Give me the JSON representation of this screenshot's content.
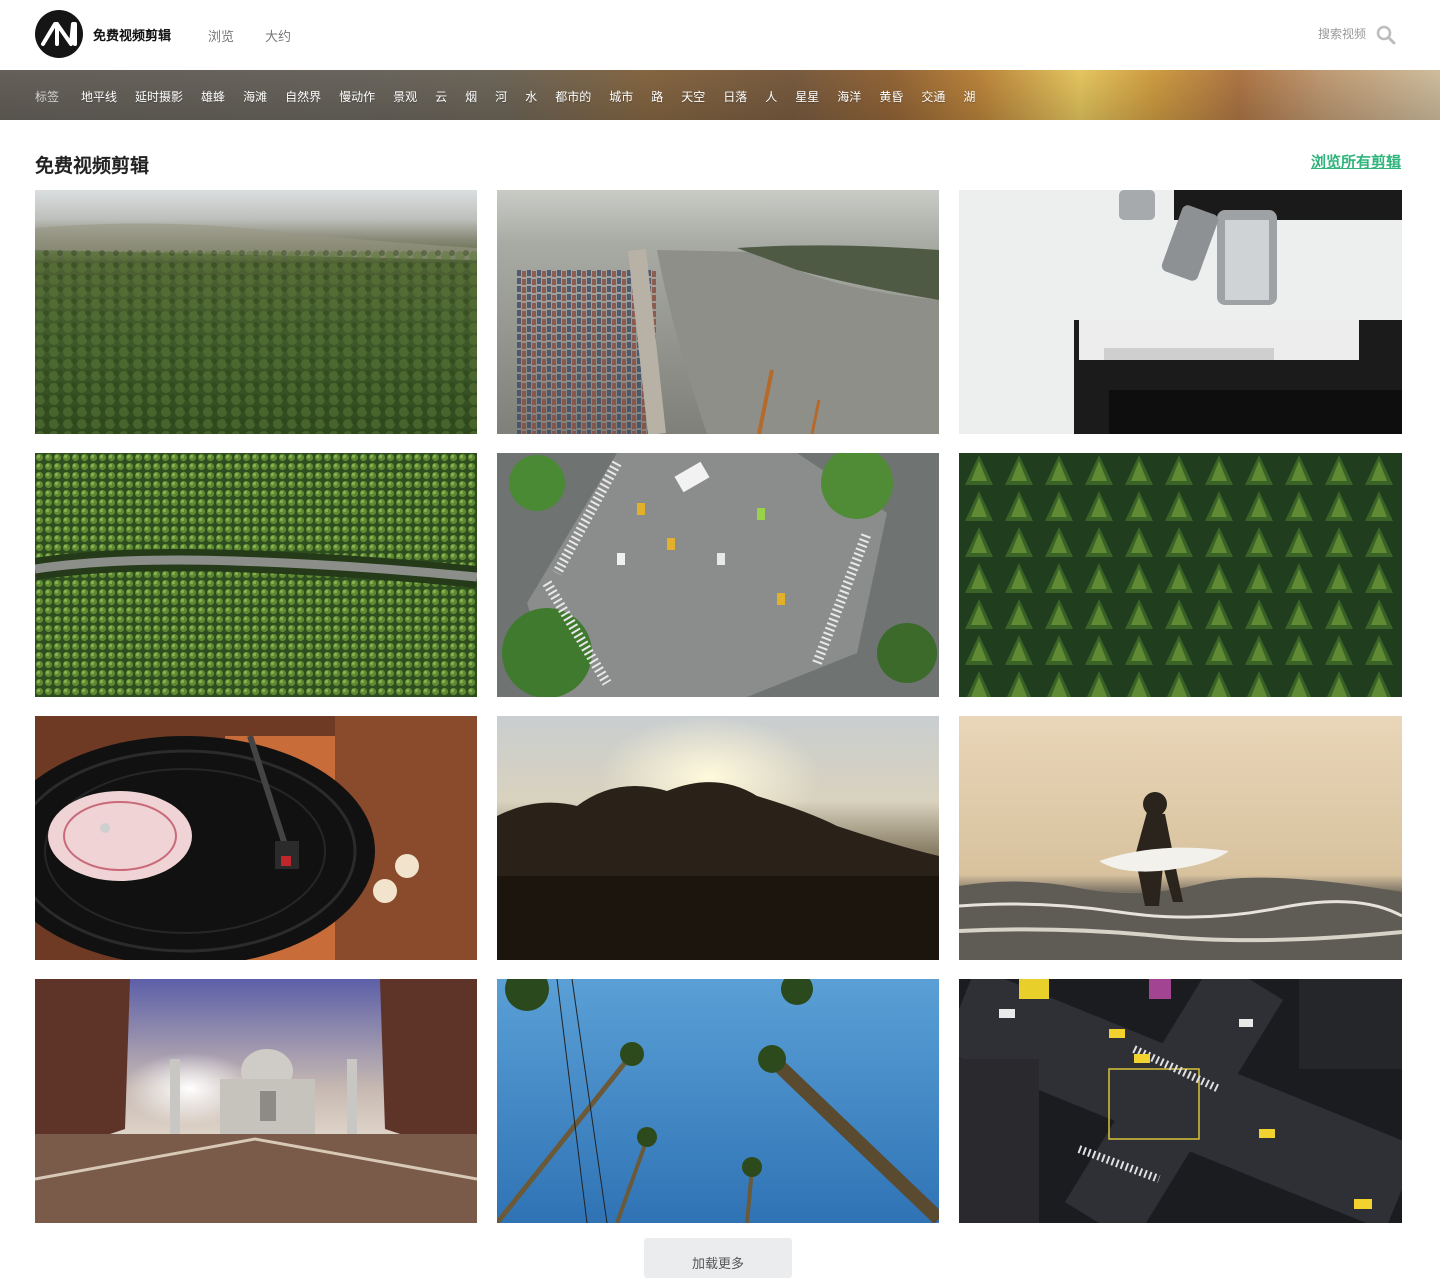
{
  "header": {
    "site_name": "免费视频剪辑",
    "nav": {
      "browse": "浏览",
      "about": "大约"
    },
    "search": {
      "placeholder": "搜索视频"
    }
  },
  "tags": {
    "label": "标签",
    "items": [
      "地平线",
      "延时摄影",
      "雄蜂",
      "海滩",
      "自然界",
      "慢动作",
      "景观",
      "云",
      "烟",
      "河",
      "水",
      "都市的",
      "城市",
      "路",
      "天空",
      "日落",
      "人",
      "星星",
      "海洋",
      "黄昏",
      "交通",
      "湖"
    ]
  },
  "section": {
    "title": "免费视频剪辑",
    "browse_all": "浏览所有剪辑"
  },
  "clips": [
    {
      "subject": "forest-hills-aerial"
    },
    {
      "subject": "port-river-aerial"
    },
    {
      "subject": "microscope"
    },
    {
      "subject": "forest-road-aerial"
    },
    {
      "subject": "intersection-aerial"
    },
    {
      "subject": "pine-forest-aerial"
    },
    {
      "subject": "vinyl-record-player"
    },
    {
      "subject": "sunset-trees"
    },
    {
      "subject": "surfer-silhouette"
    },
    {
      "subject": "taj-mahal"
    },
    {
      "subject": "palm-trees-sky"
    },
    {
      "subject": "night-intersection-aerial"
    }
  ],
  "load_more": "加载更多",
  "colors": {
    "accent": "#2fb47c",
    "logo_bg": "#151515"
  }
}
